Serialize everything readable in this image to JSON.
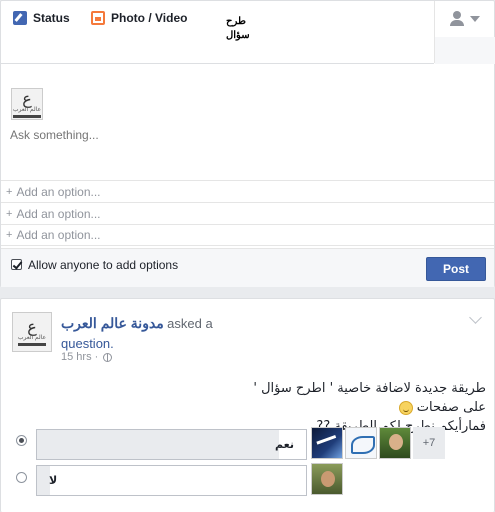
{
  "composer": {
    "tabs": {
      "status": "Status",
      "photo_video": "Photo / Video",
      "question_line1": "طرح",
      "question_line2": "سؤال"
    },
    "logo": {
      "mark": "ع",
      "word": "عالم العرب"
    },
    "ask_placeholder": "Ask something...",
    "options": [
      {
        "plus": "+",
        "placeholder": "Add an option..."
      },
      {
        "plus": "+",
        "placeholder": "Add an option..."
      },
      {
        "plus": "+",
        "placeholder": "Add an option..."
      }
    ],
    "allow_options_label": "Allow anyone to add options",
    "allow_options_checked": true,
    "post_button": "Post"
  },
  "story": {
    "page_name": "مدونة عالم العرب‏",
    "asked_text": "asked a",
    "question_link": "question.",
    "time": "15 hrs ·",
    "post_line1": "طريقة جديدة لاضافة خاصية ' اطرح سؤال ' على صفحات",
    "post_line2": "فمارأيكم نطرح لكم الطريقة ??",
    "poll_options": [
      {
        "label": "نعم",
        "selected": true,
        "fill_fraction": 0.9,
        "voters": [
          "voter-1",
          "voter-2",
          "voter-3"
        ],
        "more": "+7"
      },
      {
        "label": "لا",
        "selected": false,
        "fill_fraction": 0.05,
        "voters": [
          "voter-4"
        ],
        "more": ""
      }
    ]
  },
  "icons": {
    "status": "pencil-icon",
    "photo": "photo-icon",
    "privacy": "person-icon",
    "globe": "globe-icon",
    "emoji": "smile-emoji-icon"
  },
  "colors": {
    "brand": "#4267b2",
    "link": "#365899",
    "photo_accent": "#f5793b"
  }
}
